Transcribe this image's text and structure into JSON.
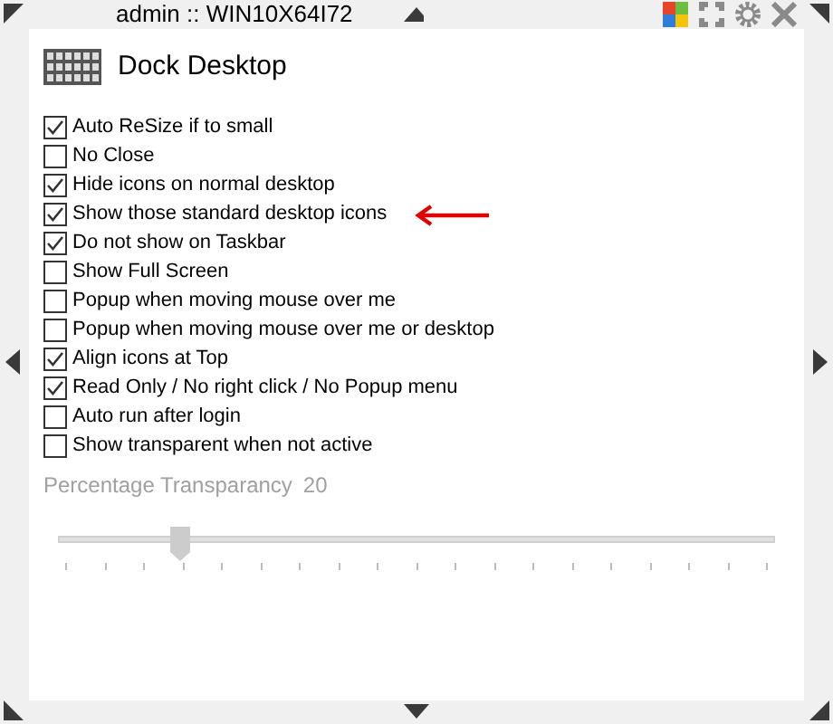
{
  "window": {
    "title": "admin :: WIN10X64I72"
  },
  "header": {
    "title": "Dock Desktop"
  },
  "options": [
    {
      "label": "Auto ReSize if to small",
      "checked": true,
      "pointed_at": false
    },
    {
      "label": "No Close",
      "checked": false,
      "pointed_at": false
    },
    {
      "label": "Hide icons on normal desktop",
      "checked": true,
      "pointed_at": false
    },
    {
      "label": "Show those standard desktop icons",
      "checked": true,
      "pointed_at": true
    },
    {
      "label": "Do not show on Taskbar",
      "checked": true,
      "pointed_at": false
    },
    {
      "label": "Show Full Screen",
      "checked": false,
      "pointed_at": false
    },
    {
      "label": "Popup when moving mouse over me",
      "checked": false,
      "pointed_at": false
    },
    {
      "label": "Popup when moving mouse over me or desktop",
      "checked": false,
      "pointed_at": false
    },
    {
      "label": "Align icons at Top",
      "checked": true,
      "pointed_at": false
    },
    {
      "label": "Read Only / No right click / No Popup menu",
      "checked": true,
      "pointed_at": false
    },
    {
      "label": "Auto run after login",
      "checked": false,
      "pointed_at": false
    },
    {
      "label": "Show transparent when not active",
      "checked": false,
      "pointed_at": false
    }
  ],
  "transparency": {
    "label": "Percentage Transparancy",
    "value": "20",
    "disabled": true,
    "level": 0.17
  }
}
